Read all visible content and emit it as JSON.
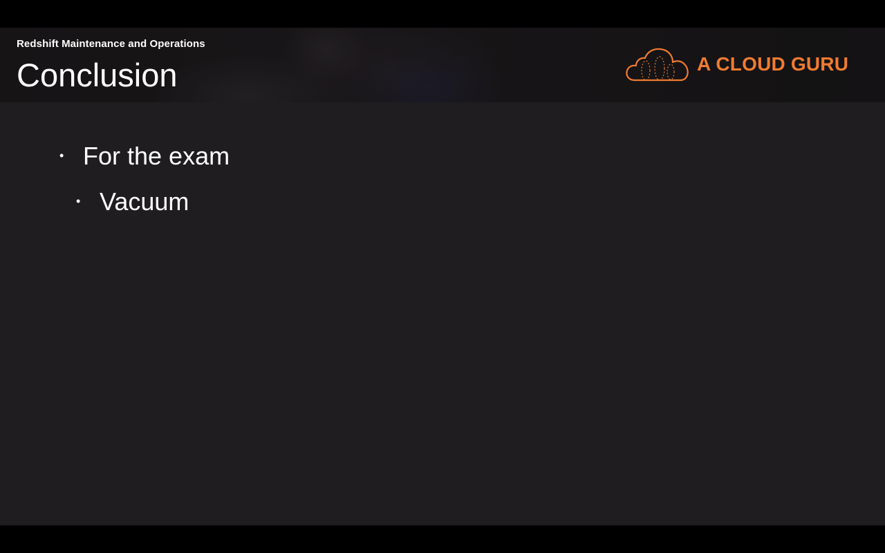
{
  "header": {
    "subtitle": "Redshift Maintenance and Operations",
    "title": "Conclusion"
  },
  "logo": {
    "icon": "cloud-logo-icon",
    "text": "A CLOUD GURU",
    "color": "#f07b32"
  },
  "bullets": [
    {
      "level": 1,
      "bullet": "•",
      "text": "For the exam"
    },
    {
      "level": 2,
      "bullet": "•",
      "text": "Vacuum"
    }
  ],
  "colors": {
    "background": "#1f1d20",
    "header_background": "#161415",
    "text": "#ffffff",
    "accent": "#f07b32"
  }
}
